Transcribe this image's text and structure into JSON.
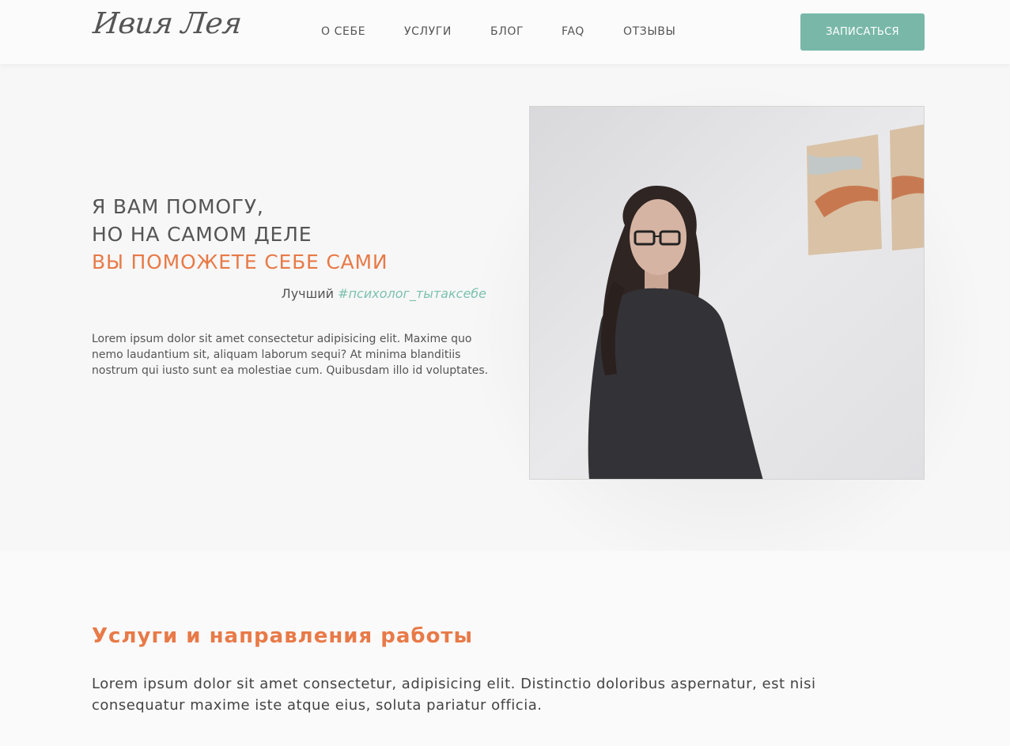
{
  "header": {
    "logo": "Ивия Лея",
    "nav": [
      "О СЕБЕ",
      "УСЛУГИ",
      "БЛОГ",
      "FAQ",
      "ОТЗЫВЫ"
    ],
    "cta_label": "ЗАПИСАТЬСЯ"
  },
  "hero": {
    "headline_line1": "Я ВАМ ПОМОГУ,",
    "headline_line2": "НО НА САМОМ ДЕЛЕ",
    "headline_accent": "ВЫ ПОМОЖЕТЕ СЕБЕ САМИ",
    "tagline_prefix": "Лучший ",
    "tagline_hashtag": "#психолог_тытаксебе",
    "text": "Lorem ipsum dolor sit amet consectetur adipisicing elit. Maxime quo nemo laudantium sit, aliquam laborum sequi? At minima blanditiis nostrum qui iusto sunt ea molestiae cum. Quibusdam illo id voluptates.",
    "photo_alt": "photo-of-psychologist"
  },
  "services": {
    "title": "Услуги и направления работы",
    "text": "Lorem ipsum dolor sit amet consectetur, adipisicing elit. Distinctio doloribus aspernatur, est nisi consequatur maxime iste atque eius, soluta pariatur officia."
  },
  "colors": {
    "accent": "#e87a48",
    "teal": "#79b8a8",
    "text": "#555555"
  }
}
